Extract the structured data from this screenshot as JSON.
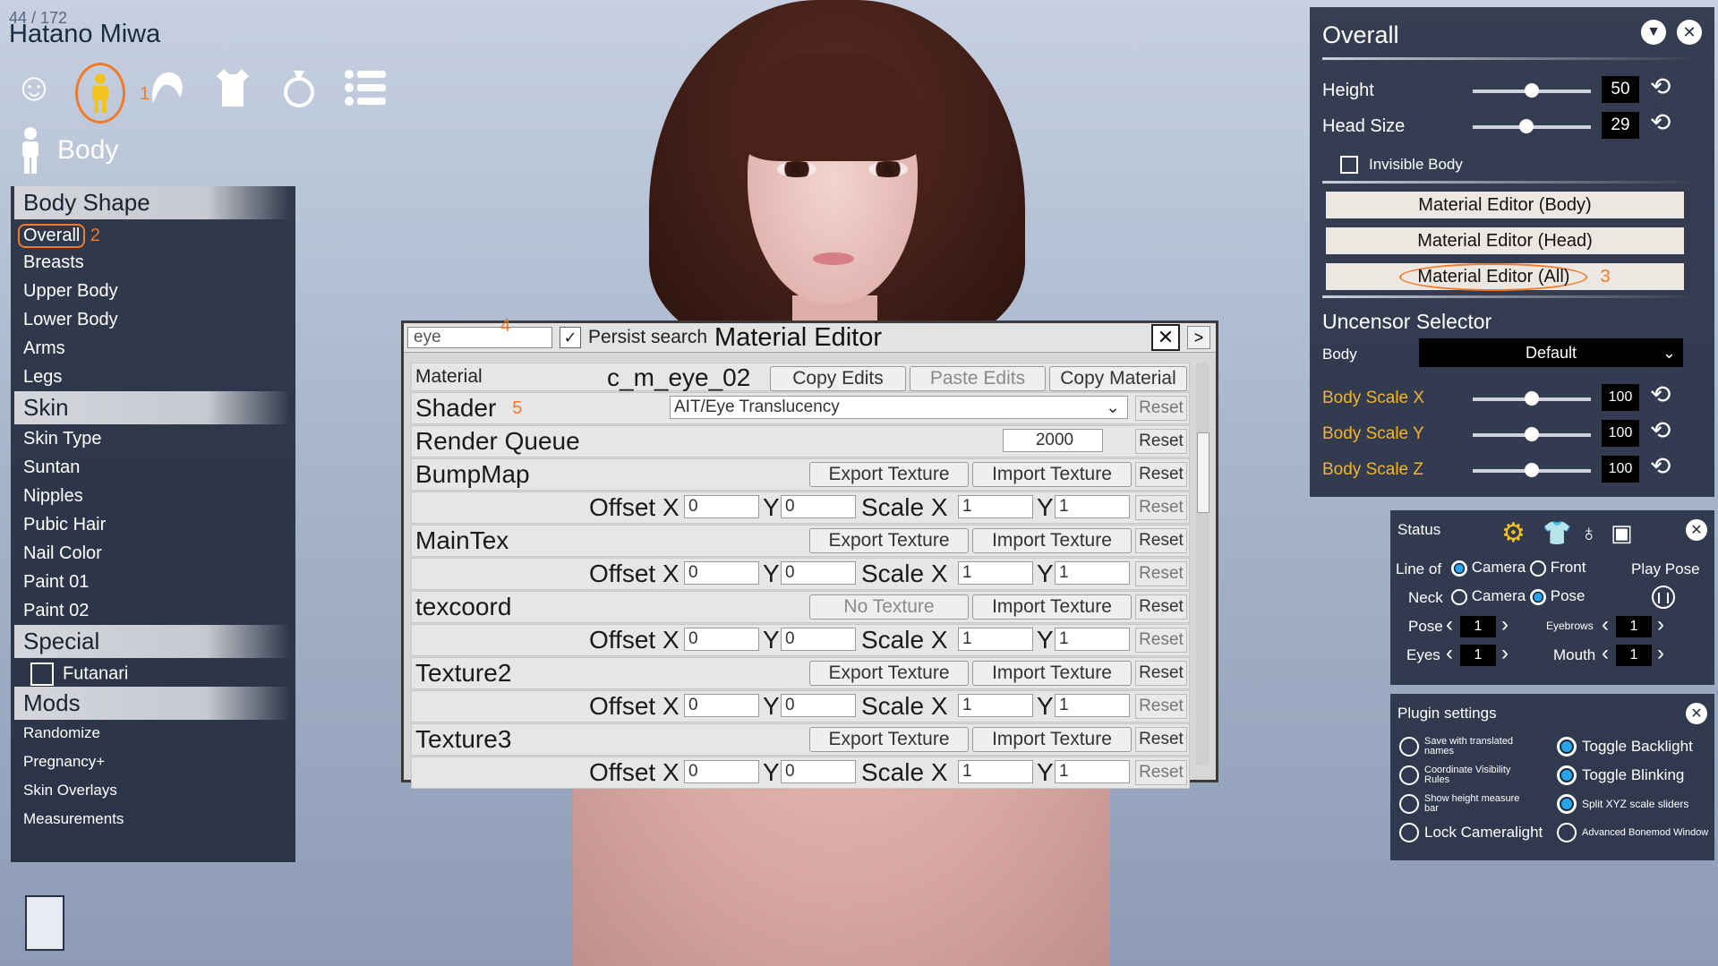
{
  "counter": "44 / 172",
  "character_name": "Hatano Miwa",
  "top_icons": [
    "face-icon",
    "body-icon",
    "hair-icon",
    "clothes-icon",
    "accessory-icon",
    "list-icon"
  ],
  "section_title": "Body",
  "left_menu": {
    "body_shape": {
      "title": "Body Shape",
      "items": [
        "Overall",
        "Breasts",
        "Upper Body",
        "Lower Body",
        "Arms",
        "Legs"
      ]
    },
    "skin": {
      "title": "Skin",
      "items": [
        "Skin Type",
        "Suntan",
        "Nipples",
        "Pubic Hair",
        "Nail Color",
        "Paint 01",
        "Paint 02"
      ]
    },
    "special": {
      "title": "Special",
      "futanari_label": "Futanari"
    },
    "mods": {
      "title": "Mods",
      "items": [
        "Randomize",
        "Pregnancy+",
        "Skin Overlays",
        "Measurements"
      ]
    }
  },
  "annotations": [
    "1",
    "2",
    "3",
    "4",
    "5"
  ],
  "material_editor": {
    "search_value": "eye",
    "persist_label": "Persist search",
    "title": "Material Editor",
    "next_label": ">",
    "material_label": "Material",
    "material_name": "c_m_eye_02",
    "copy_edits": "Copy Edits",
    "paste_edits": "Paste Edits",
    "copy_material": "Copy Material",
    "shader_label": "Shader",
    "shader_value": "AIT/Eye Translucency",
    "reset": "Reset",
    "render_queue_label": "Render Queue",
    "render_queue_value": "2000",
    "export_texture": "Export Texture",
    "import_texture": "Import Texture",
    "no_texture": "No Texture",
    "offset_x": "Offset X",
    "y": "Y",
    "scale_x": "Scale X",
    "textures": [
      {
        "name": "BumpMap",
        "ox": "0",
        "oy": "0",
        "sx": "1",
        "sy": "1"
      },
      {
        "name": "MainTex",
        "ox": "0",
        "oy": "0",
        "sx": "1",
        "sy": "1"
      },
      {
        "name": "texcoord",
        "ox": "0",
        "oy": "0",
        "sx": "1",
        "sy": "1"
      },
      {
        "name": "Texture2",
        "ox": "0",
        "oy": "0",
        "sx": "1",
        "sy": "1"
      },
      {
        "name": "Texture3",
        "ox": "0",
        "oy": "0",
        "sx": "1",
        "sy": "1"
      }
    ]
  },
  "overall_panel": {
    "title": "Overall",
    "height_label": "Height",
    "height_value": "50",
    "height_level": 0.5,
    "head_label": "Head Size",
    "head_value": "29",
    "head_level": 0.45,
    "invisible_label": "Invisible Body",
    "me_body": "Material Editor (Body)",
    "me_head": "Material Editor (Head)",
    "me_all": "Material Editor (All)",
    "uncensor_title": "Uncensor Selector",
    "body_label": "Body",
    "body_value": "Default",
    "scale_x_label": "Body Scale X",
    "scale_x_value": "100",
    "scale_y_label": "Body Scale Y",
    "scale_y_value": "100",
    "scale_z_label": "Body Scale Z",
    "scale_z_value": "100",
    "accent": "#f0b530"
  },
  "status_panel": {
    "title": "Status",
    "line_of_label": "Line of",
    "camera_label": "Camera",
    "front_label": "Front",
    "play_pose_label": "Play Pose",
    "neck_label": "Neck",
    "pose_option_label": "Pose",
    "pose_label": "Pose",
    "pose_value": "1",
    "eyebrows_label": "Eyebrows",
    "eyebrows_value": "1",
    "eyes_label": "Eyes",
    "eyes_value": "1",
    "mouth_label": "Mouth",
    "mouth_value": "1"
  },
  "plugin_panel": {
    "title": "Plugin settings",
    "save_translated": "Save with translated names",
    "toggle_backlight": "Toggle Backlight",
    "coord_visibility": "Coordinate Visibility Rules",
    "toggle_blinking": "Toggle Blinking",
    "show_height": "Show height measure bar",
    "split_xyz": "Split XYZ scale sliders",
    "lock_cameralight": "Lock Cameralight",
    "advanced_bonemod": "Advanced Bonemod Window"
  }
}
